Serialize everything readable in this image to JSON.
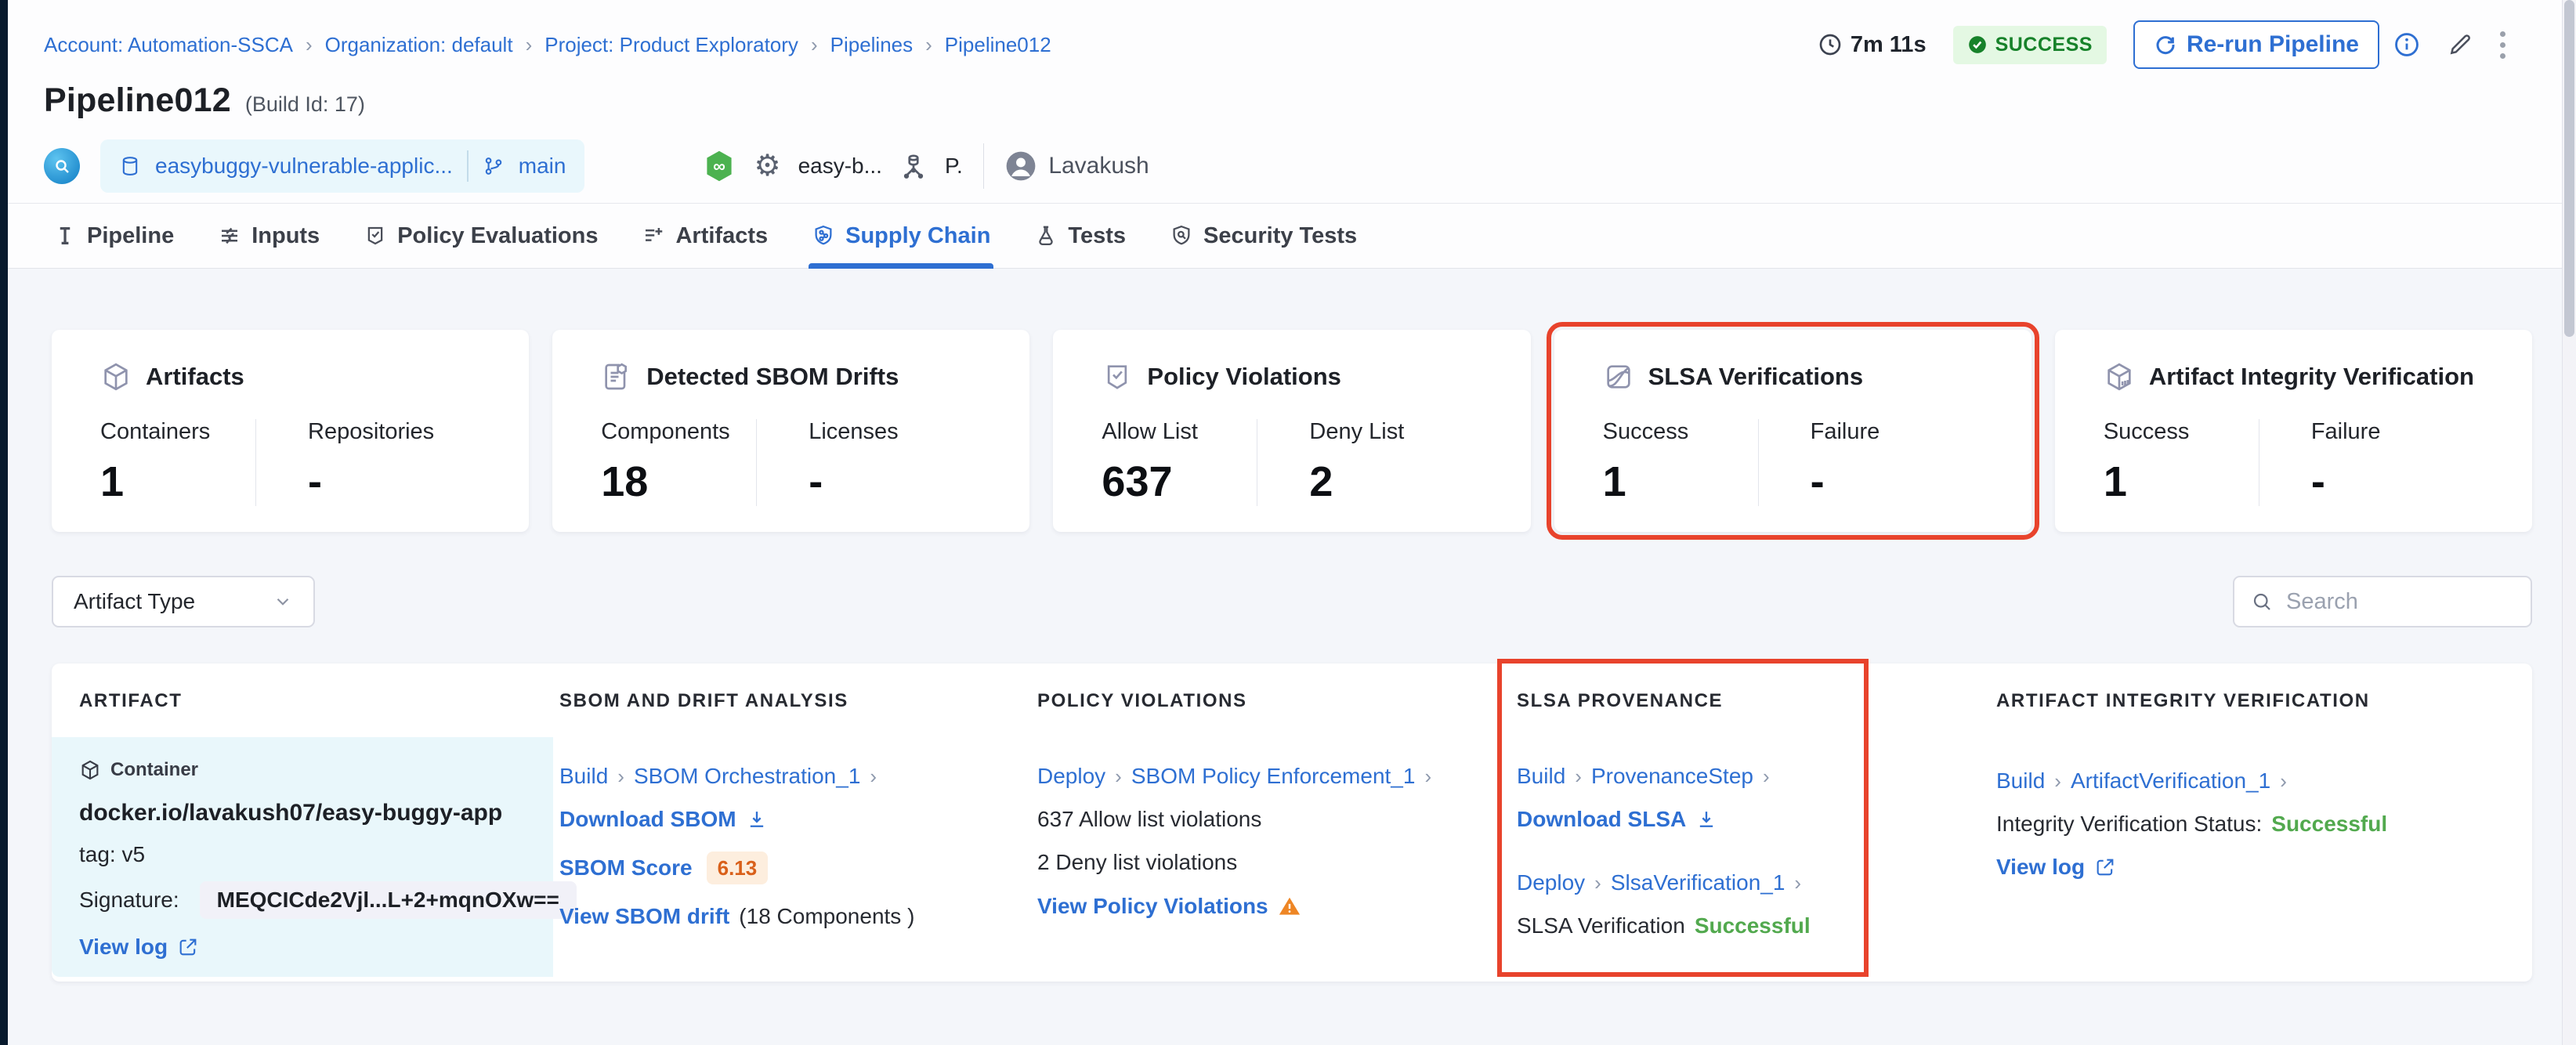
{
  "colors": {
    "accent_blue": "#2e6fd2",
    "success_green_text": "#52a94e",
    "badge_green_bg": "#e4f8e3",
    "badge_green_text": "#17822a",
    "highlight_red": "#e8432c",
    "score_orange_text": "#d9601a",
    "score_orange_bg": "#fdeede",
    "warning_orange": "#ee8625",
    "artifact_cell_bg": "#e9f7fb",
    "page_bg": "#f4f6fa"
  },
  "misc": {
    "chevron": "›",
    "infinity": "∞",
    "gear": "⚙",
    "dash": "-"
  },
  "breadcrumb": {
    "items": [
      "Account: Automation-SSCA",
      "Organization: default",
      "Project: Product Exploratory",
      "Pipelines",
      "Pipeline012"
    ]
  },
  "header": {
    "duration": "7m 11s",
    "status_badge": "SUCCESS",
    "rerun_button": "Re-run Pipeline",
    "title": "Pipeline012",
    "build_id": "(Build Id: 17)",
    "repo_name": "easybuggy-vulnerable-applic...",
    "repo_branch": "main",
    "pipeline_ref": "easy-b...",
    "stage_ref": "P.",
    "user_name": "Lavakush"
  },
  "tabs": [
    {
      "label": "Pipeline",
      "icon": "pipeline-icon"
    },
    {
      "label": "Inputs",
      "icon": "inputs-icon"
    },
    {
      "label": "Policy Evaluations",
      "icon": "policy-evaluations-icon"
    },
    {
      "label": "Artifacts",
      "icon": "artifacts-icon"
    },
    {
      "label": "Supply Chain",
      "icon": "supply-chain-icon",
      "active": true
    },
    {
      "label": "Tests",
      "icon": "tests-icon"
    },
    {
      "label": "Security Tests",
      "icon": "security-tests-icon"
    }
  ],
  "summary_cards": [
    {
      "title": "Artifacts",
      "icon": "cube-icon",
      "stats": [
        {
          "label": "Containers",
          "value": "1"
        },
        {
          "label": "Repositories",
          "value": "-"
        }
      ]
    },
    {
      "title": "Detected SBOM Drifts",
      "icon": "sbom-document-icon",
      "stats": [
        {
          "label": "Components",
          "value": "18"
        },
        {
          "label": "Licenses",
          "value": "-"
        }
      ]
    },
    {
      "title": "Policy Violations",
      "icon": "shield-check-icon",
      "stats": [
        {
          "label": "Allow List",
          "value": "637"
        },
        {
          "label": "Deny List",
          "value": "2"
        }
      ]
    },
    {
      "title": "SLSA Verifications",
      "icon": "slsa-icon",
      "highlighted": true,
      "stats": [
        {
          "label": "Success",
          "value": "1"
        },
        {
          "label": "Failure",
          "value": "-"
        }
      ]
    },
    {
      "title": "Artifact Integrity Verification",
      "icon": "cube-verified-icon",
      "stats": [
        {
          "label": "Success",
          "value": "1"
        },
        {
          "label": "Failure",
          "value": "-"
        }
      ]
    }
  ],
  "filters": {
    "artifact_type": "Artifact Type",
    "search_placeholder": "Search"
  },
  "table": {
    "headers": [
      "ARTIFACT",
      "SBOM AND DRIFT ANALYSIS",
      "POLICY VIOLATIONS",
      "SLSA PROVENANCE",
      "ARTIFACT INTEGRITY VERIFICATION"
    ],
    "row": {
      "artifact": {
        "type_badge": "Container",
        "name": "docker.io/lavakush07/easy-buggy-app",
        "tag": "tag: v5",
        "signature_label": "Signature:",
        "signature_value": "MEQCICde2Vjl...L+2+mqnOXw==",
        "view_log": "View log"
      },
      "sbom": {
        "crumb": [
          "Build",
          "SBOM Orchestration_1"
        ],
        "download": "Download SBOM",
        "score_label": "SBOM Score",
        "score_value": "6.13",
        "drift_link": "View SBOM drift",
        "drift_suffix": "(18 Components )"
      },
      "policy": {
        "crumb": [
          "Deploy",
          "SBOM Policy Enforcement_1"
        ],
        "allow_line": "637 Allow list violations",
        "deny_line": "2 Deny list violations",
        "view_link": "View Policy Violations"
      },
      "slsa": {
        "crumb1": [
          "Build",
          "ProvenanceStep"
        ],
        "download": "Download SLSA",
        "crumb2": [
          "Deploy",
          "SlsaVerification_1"
        ],
        "status_label": "SLSA Verification",
        "status_value": "Successful"
      },
      "integrity": {
        "crumb": [
          "Build",
          "ArtifactVerification_1"
        ],
        "status_label": "Integrity Verification Status:",
        "status_value": "Successful",
        "view_log": "View log"
      }
    }
  }
}
